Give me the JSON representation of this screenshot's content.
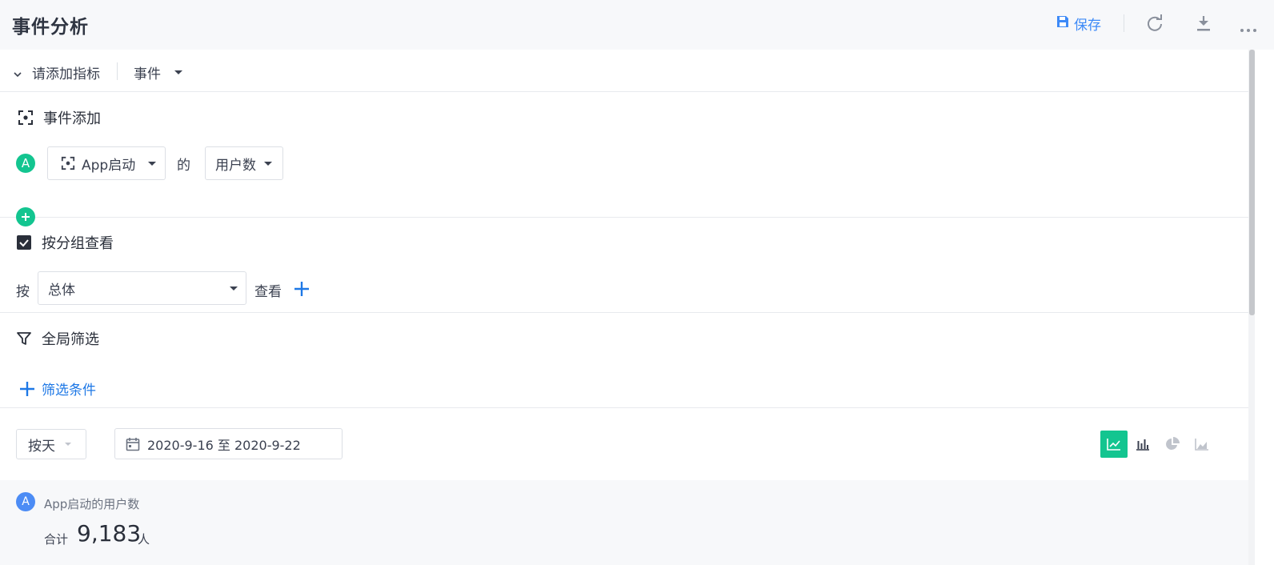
{
  "header": {
    "title": "事件分析",
    "save_label": "保存",
    "icons": [
      "save-icon",
      "refresh-icon",
      "download-icon",
      "more-icon"
    ]
  },
  "metric_bar": {
    "label": "请添加指标",
    "event_select": "事件"
  },
  "event_section": {
    "title": "事件添加",
    "row": {
      "badge": "A",
      "event_value": "App启动",
      "connector": "的",
      "measure_value": "用户数"
    }
  },
  "group_section": {
    "title": "按分组查看",
    "prefix": "按",
    "group_value": "总体",
    "suffix": "查看"
  },
  "filter_section": {
    "title": "全局筛选",
    "add_label": "筛选条件"
  },
  "toolbar": {
    "granularity": "按天",
    "date_range": "2020-9-16 至 2020-9-22",
    "chart_types": [
      "line-chart-icon",
      "bar-chart-icon",
      "pie-chart-icon",
      "area-chart-icon"
    ],
    "active_chart": "line-chart-icon"
  },
  "result": {
    "badge": "A",
    "metric_name": "App启动的用户数",
    "total_label": "合计",
    "total_value": "9,183",
    "unit": "人"
  },
  "colors": {
    "accent_green": "#13c590",
    "accent_blue": "#1e78e6",
    "result_badge": "#4c8cf5"
  }
}
